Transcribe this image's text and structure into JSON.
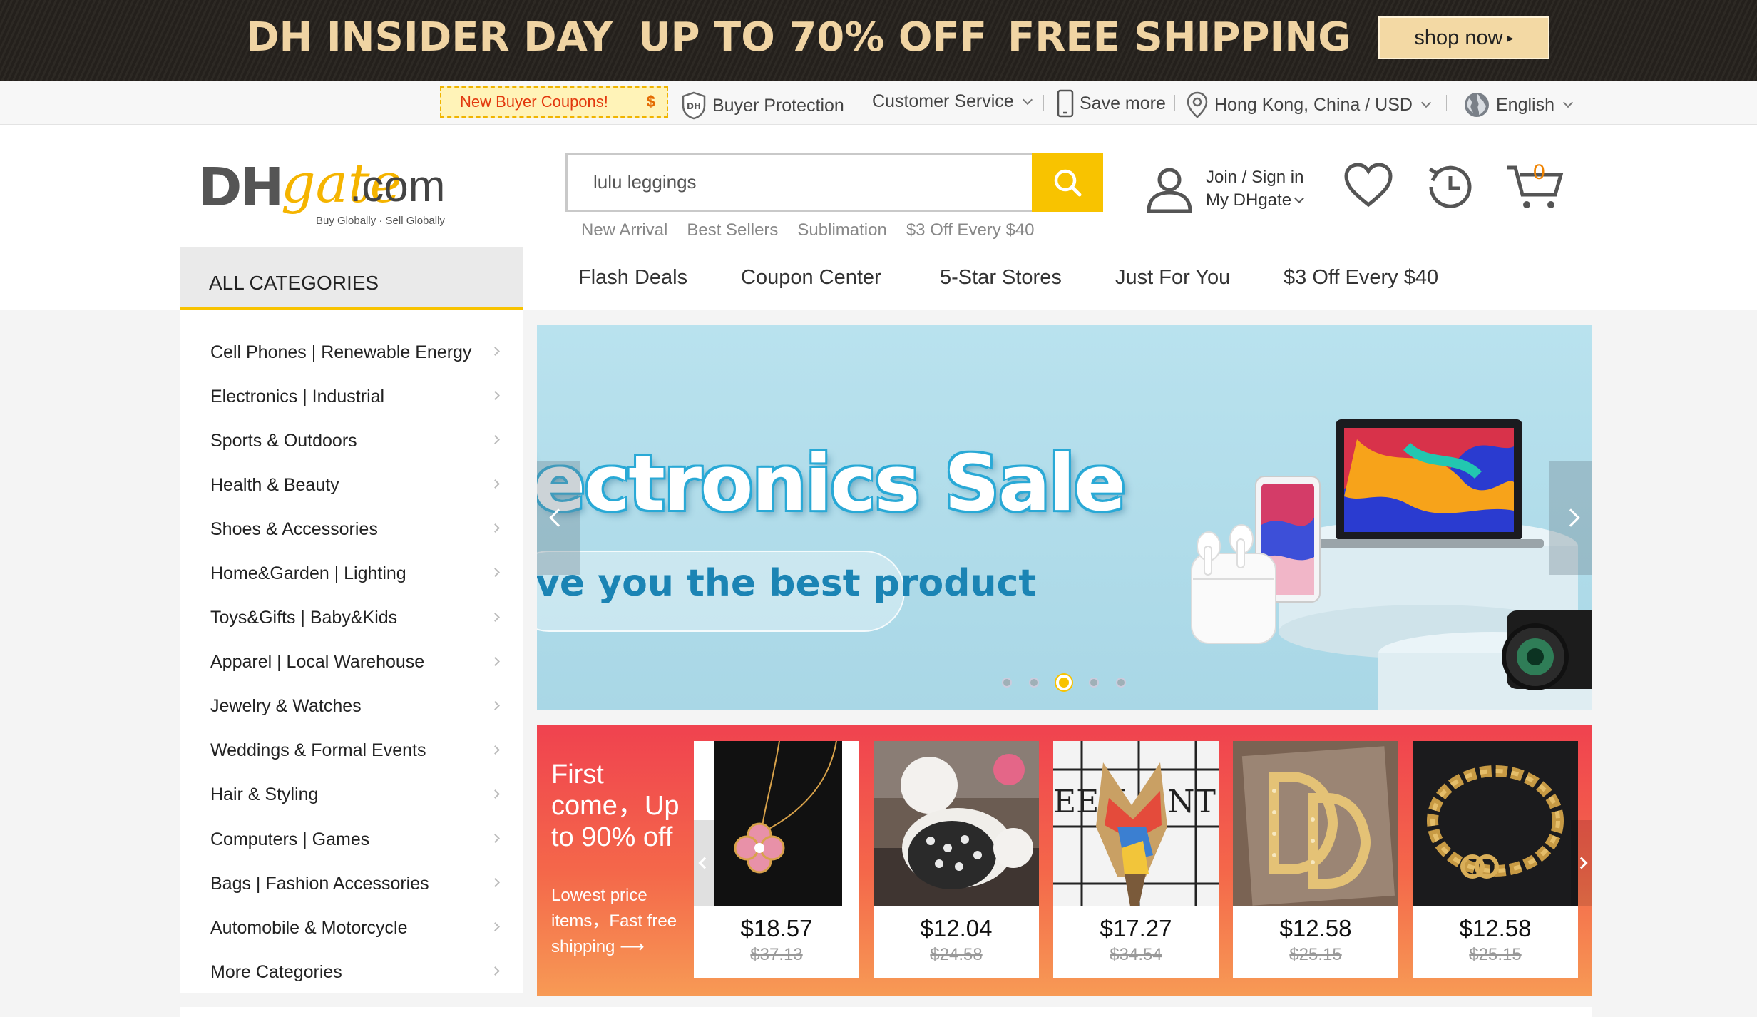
{
  "promo": {
    "text1": "DH INSIDER DAY",
    "text2": "UP TO 70% OFF",
    "text3": "FREE SHIPPING",
    "cta": "shop now",
    "text_color": "#f0d4a3"
  },
  "util": {
    "coupon": "New Buyer Coupons!",
    "coupon_symbol": "$",
    "buyer_protection": "Buyer Protection",
    "customer_service": "Customer Service",
    "save_more": "Save more",
    "region": "Hong Kong, China / USD",
    "language": "English"
  },
  "header": {
    "logo_dh": "DH",
    "logo_gate": "gate",
    "logo_com": ".com",
    "logo_tagline": "Buy Globally · Sell Globally",
    "search_value": "lulu leggings",
    "hot_links": [
      "New Arrival",
      "Best Sellers",
      "Sublimation",
      "$3 Off Every $40"
    ],
    "account_line1": "Join / Sign in",
    "account_line2": "My DHgate",
    "cart_count": "0",
    "accent": "#f8c300"
  },
  "nav": {
    "all_categories": "ALL CATEGORIES",
    "links": [
      "Flash Deals",
      "Coupon Center",
      "5-Star Stores",
      "Just For You",
      "$3 Off Every $40"
    ]
  },
  "categories": [
    "Cell Phones  |  Renewable Energy",
    "Electronics  |  Industrial",
    "Sports & Outdoors",
    "Health & Beauty",
    "Shoes & Accessories",
    "Home&Garden  |  Lighting",
    "Toys&Gifts  |  Baby&Kids",
    "Apparel  |  Local Warehouse",
    "Jewelry & Watches",
    "Weddings & Formal Events",
    "Hair & Styling",
    "Computers  |  Games",
    "Bags  |  Fashion Accessories",
    "Automobile & Motorcycle",
    "More Categories"
  ],
  "hero": {
    "title": "lectronics Sale",
    "subtitle": "ve you the best product",
    "slide_count": 5,
    "active_slide": 3
  },
  "deals": {
    "heading": "First come，Up to 90% off",
    "subheading": "Lowest price items，Fast free shipping ⟶",
    "items": [
      {
        "price": "$18.57",
        "old_price": "$37.13",
        "icon": "pendant-necklace-image"
      },
      {
        "price": "$12.04",
        "old_price": "$24.58",
        "icon": "dog-sweater-image"
      },
      {
        "price": "$17.27",
        "old_price": "$34.54",
        "icon": "swimsuit-image"
      },
      {
        "price": "$12.58",
        "old_price": "$25.15",
        "icon": "earrings-image"
      },
      {
        "price": "$12.58",
        "old_price": "$25.15",
        "icon": "chain-bracelet-image"
      }
    ]
  }
}
